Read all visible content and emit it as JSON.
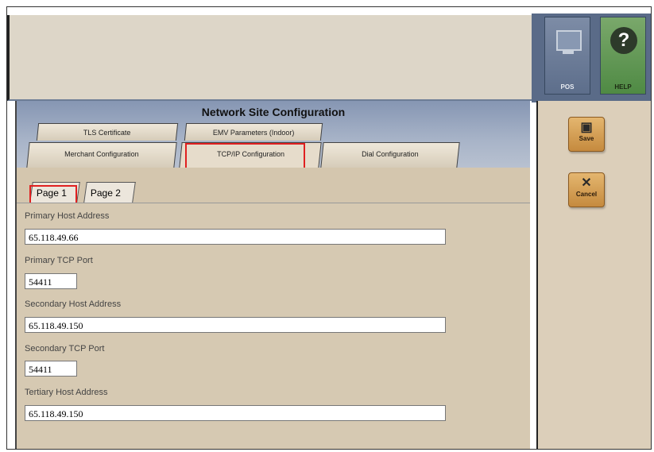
{
  "toolbar": {
    "pos_label": "POS",
    "help_label": "HELP",
    "pos_icon": "monitor-icon",
    "help_icon": "question-icon"
  },
  "actions": {
    "save_label": "Save",
    "cancel_label": "Cancel",
    "save_icon": "save-icon",
    "cancel_icon": "close-icon"
  },
  "page": {
    "title": "Network Site Configuration"
  },
  "tabs": {
    "row1": [
      "TLS Certificate",
      "EMV Parameters (Indoor)"
    ],
    "row2": [
      "Merchant Configuration",
      "TCP/IP Configuration",
      "Dial Configuration"
    ],
    "active": "TCP/IP Configuration"
  },
  "subtabs": [
    "Page 1",
    "Page 2"
  ],
  "fields": [
    {
      "label": "Primary Host Address",
      "value": "65.118.49.66"
    },
    {
      "label": "Primary TCP Port",
      "value": "54411"
    },
    {
      "label": "Secondary Host Address",
      "value": "65.118.49.150"
    },
    {
      "label": "Secondary TCP Port",
      "value": "54411"
    },
    {
      "label": "Tertiary Host Address",
      "value": "65.118.49.150"
    }
  ],
  "colors": {
    "highlight": "#e02020",
    "header_band": "#8696b3",
    "panel": "#d4c6ae"
  }
}
